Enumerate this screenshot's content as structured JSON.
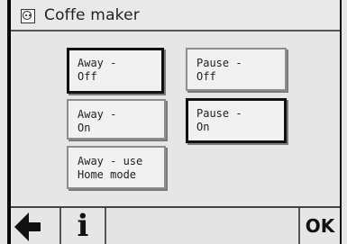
{
  "header": {
    "title": "Coffe maker",
    "icon": "socket-icon"
  },
  "modes": [
    {
      "label": "Away -\nOff",
      "selected": true
    },
    {
      "label": "Pause -\nOff",
      "selected": false
    },
    {
      "label": "Away -\nOn",
      "selected": false
    },
    {
      "label": "Pause -\nOn",
      "selected": true
    },
    {
      "label": "Away - use\nHome mode",
      "selected": false
    }
  ],
  "footer": {
    "back_icon": "arrow-left-icon",
    "info_icon": "info-icon",
    "info_label": "i",
    "ok_label": "OK"
  }
}
